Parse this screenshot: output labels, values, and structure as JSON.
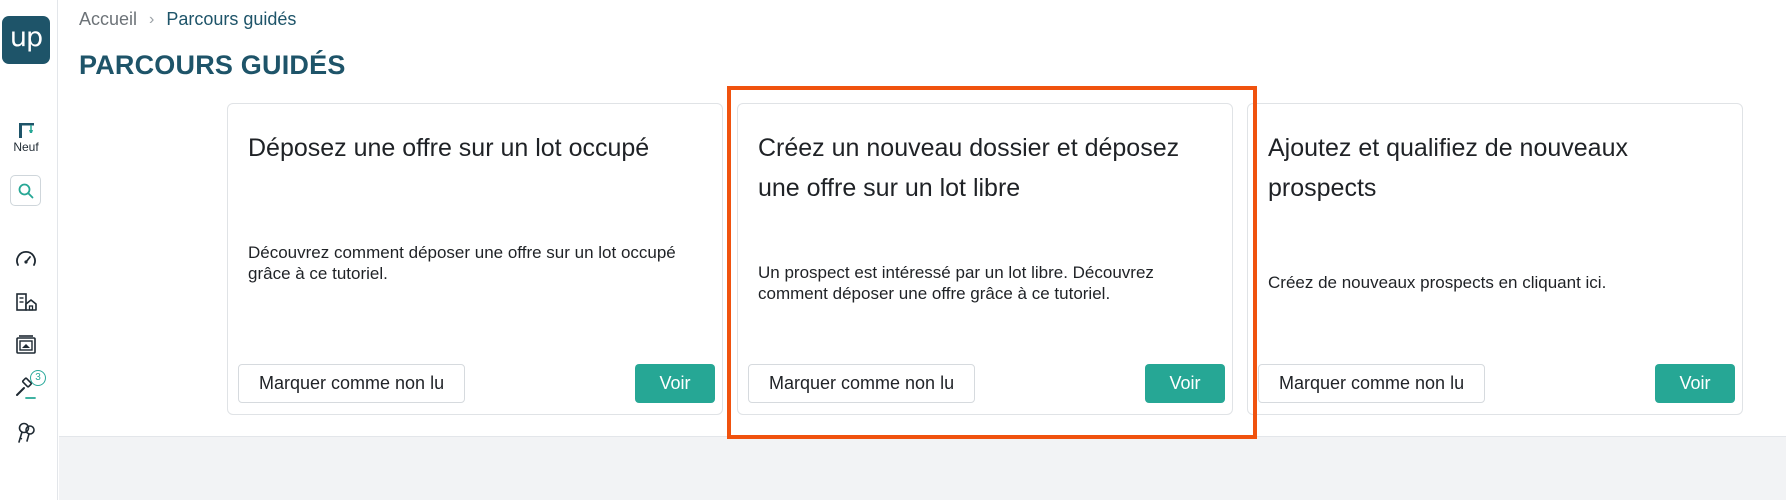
{
  "sidebar": {
    "logo_text": "up",
    "neuf_label": "Neuf",
    "icons": [
      "crane-icon",
      "search-icon",
      "speedometer-icon",
      "buildings-icon",
      "gallery-icon",
      "gavel-icon",
      "keys-icon"
    ],
    "notification_count": "3"
  },
  "breadcrumb": {
    "home": "Accueil",
    "current": "Parcours guidés"
  },
  "page": {
    "title": "PARCOURS GUIDÉS"
  },
  "cards": [
    {
      "title": "Déposez une offre sur un lot occupé",
      "description": "Découvrez comment déposer une offre sur un lot occupé grâce à ce tutoriel.",
      "secondary_label": "Marquer comme non lu",
      "primary_label": "Voir"
    },
    {
      "title": "Créez un nouveau dossier et déposez une offre sur un lot libre",
      "description": "Un prospect est intéressé par un lot libre. Découvrez comment déposer une offre grâce à ce tutoriel.",
      "secondary_label": "Marquer comme non lu",
      "primary_label": "Voir"
    },
    {
      "title": "Ajoutez et qualifiez de nouveaux prospects",
      "description": "Créez de nouveaux prospects en cliquant ici.",
      "secondary_label": "Marquer comme non lu",
      "primary_label": "Voir"
    }
  ],
  "colors": {
    "brand": "#1e5469",
    "accent": "#26a795",
    "highlight": "#f0520e"
  }
}
